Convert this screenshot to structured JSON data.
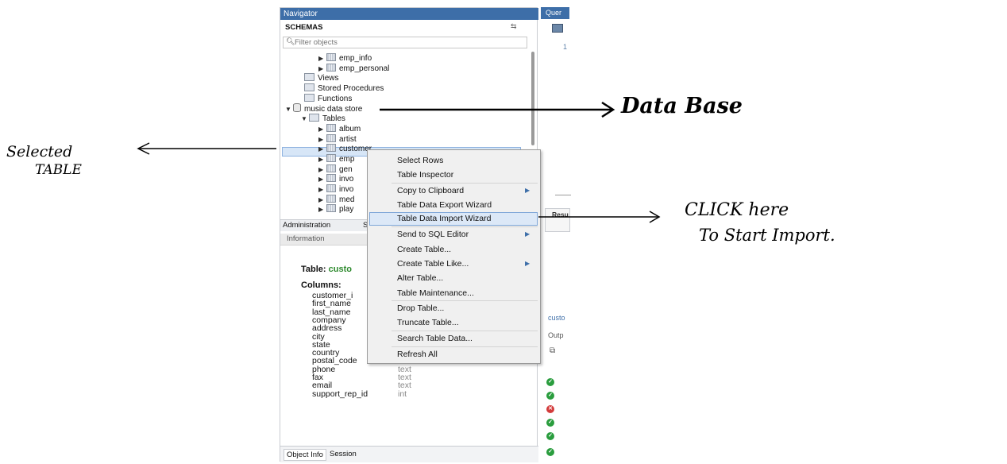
{
  "navigator": {
    "title": "Navigator",
    "schemas_label": "SCHEMAS",
    "filter_placeholder": "Filter objects",
    "tree": [
      {
        "label": "emp_info",
        "kind": "table",
        "indent": 2
      },
      {
        "label": "emp_personal",
        "kind": "table",
        "indent": 2
      },
      {
        "label": "Views",
        "kind": "folder",
        "indent": 1
      },
      {
        "label": "Stored Procedures",
        "kind": "folder",
        "indent": 1
      },
      {
        "label": "Functions",
        "kind": "folder",
        "indent": 1
      },
      {
        "label": "music data store",
        "kind": "database",
        "indent": 0
      },
      {
        "label": "Tables",
        "kind": "folder-open",
        "indent": 1
      },
      {
        "label": "album",
        "kind": "table",
        "indent": 2
      },
      {
        "label": "artist",
        "kind": "table",
        "indent": 2
      },
      {
        "label": "customer",
        "kind": "table",
        "indent": 2,
        "selected": true
      },
      {
        "label": "emp",
        "kind": "table",
        "indent": 2
      },
      {
        "label": "gen",
        "kind": "table",
        "indent": 2
      },
      {
        "label": "invo",
        "kind": "table",
        "indent": 2
      },
      {
        "label": "invo",
        "kind": "table",
        "indent": 2
      },
      {
        "label": "med",
        "kind": "table",
        "indent": 2
      },
      {
        "label": "play",
        "kind": "table",
        "indent": 2
      }
    ],
    "tab_administration": "Administration",
    "tab_schemas_partial": "S",
    "information_label": "Information",
    "table_label": "Table:",
    "table_name": "custo",
    "columns_label": "Columns:",
    "columns": [
      {
        "name": "customer_i",
        "type": ""
      },
      {
        "name": "first_name",
        "type": ""
      },
      {
        "name": "last_name",
        "type": ""
      },
      {
        "name": "company",
        "type": ""
      },
      {
        "name": "address",
        "type": ""
      },
      {
        "name": "city",
        "type": ""
      },
      {
        "name": "state",
        "type": ""
      },
      {
        "name": "country",
        "type": ""
      },
      {
        "name": "postal_code",
        "type": "text"
      },
      {
        "name": "phone",
        "type": "text"
      },
      {
        "name": "fax",
        "type": "text"
      },
      {
        "name": "email",
        "type": "text"
      },
      {
        "name": "support_rep_id",
        "type": "int"
      }
    ],
    "tab_object_info": "Object Info",
    "tab_session": "Session"
  },
  "right_panel": {
    "query_tab_partial": "Quer",
    "line_number": "1",
    "result_partial": "Resu",
    "custo_partial": "custo",
    "output_partial": "Outp",
    "status_rows": [
      "ok",
      "ok",
      "error",
      "ok",
      "ok",
      "ok"
    ]
  },
  "context_menu": {
    "items": [
      {
        "label": "Select Rows"
      },
      {
        "label": "Table Inspector"
      },
      {
        "label": "Copy to Clipboard",
        "submenu": true,
        "sep_before": true
      },
      {
        "label": "Table Data Export Wizard"
      },
      {
        "label": "Table Data Import Wizard",
        "highlighted": true
      },
      {
        "label": "Send to SQL Editor",
        "submenu": true,
        "sep_before": true
      },
      {
        "label": "Create Table..."
      },
      {
        "label": "Create Table Like...",
        "submenu": true
      },
      {
        "label": "Alter Table..."
      },
      {
        "label": "Table Maintenance..."
      },
      {
        "label": "Drop Table...",
        "sep_before": true
      },
      {
        "label": "Truncate Table..."
      },
      {
        "label": "Search Table Data...",
        "sep_before": true
      },
      {
        "label": "Refresh All",
        "sep_before": true
      }
    ]
  },
  "annotations": {
    "database_label": "Data Base",
    "selected_line1": "Selected",
    "selected_line2": "TABLE",
    "click_line1": "CLICK here",
    "click_line2": "To Start Import."
  }
}
